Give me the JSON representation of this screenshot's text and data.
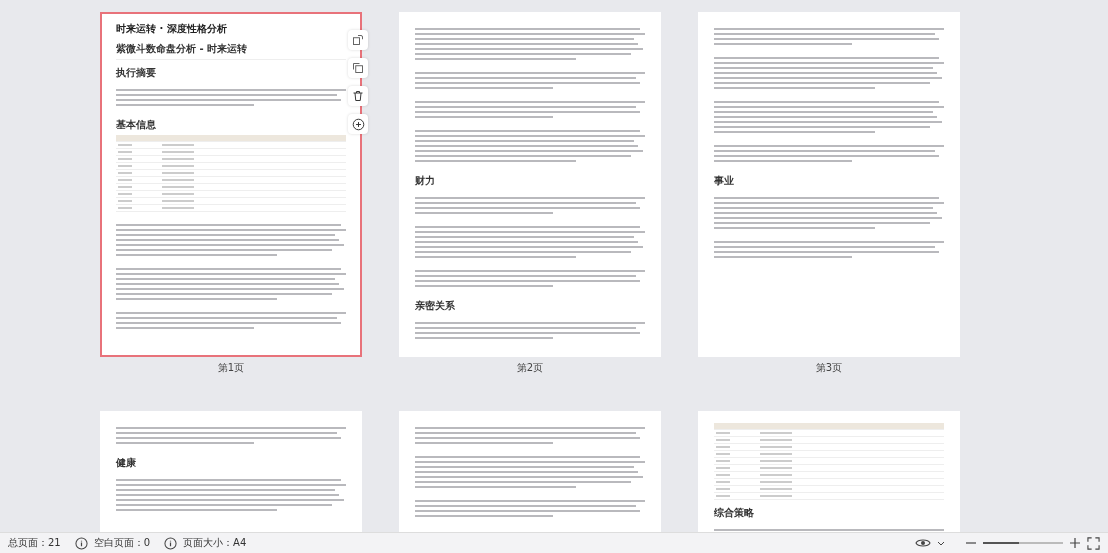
{
  "pages": [
    {
      "label": "第1页",
      "selected": true,
      "blocks": [
        {
          "kind": "h1",
          "text": "时来运转 · 深度性格分析"
        },
        {
          "kind": "h2",
          "text": "紫微斗数命盘分析 - 时来运转"
        },
        {
          "kind": "h3",
          "text": "执行摘要"
        },
        {
          "kind": "para"
        },
        {
          "kind": "h3",
          "text": "基本信息"
        },
        {
          "kind": "table"
        },
        {
          "kind": "para-long"
        },
        {
          "kind": "para-long"
        },
        {
          "kind": "para"
        }
      ]
    },
    {
      "label": "第2页",
      "selected": false,
      "blocks": [
        {
          "kind": "para-long"
        },
        {
          "kind": "para"
        },
        {
          "kind": "para"
        },
        {
          "kind": "para-long"
        },
        {
          "kind": "h3",
          "text": "财力"
        },
        {
          "kind": "para"
        },
        {
          "kind": "para-long"
        },
        {
          "kind": "para"
        },
        {
          "kind": "h3",
          "text": "亲密关系"
        },
        {
          "kind": "para"
        }
      ]
    },
    {
      "label": "第3页",
      "selected": false,
      "blocks": [
        {
          "kind": "para"
        },
        {
          "kind": "para-long"
        },
        {
          "kind": "para-long"
        },
        {
          "kind": "para"
        },
        {
          "kind": "h3",
          "text": "事业"
        },
        {
          "kind": "para-long"
        },
        {
          "kind": "para"
        }
      ]
    },
    {
      "selected": false,
      "blocks": [
        {
          "kind": "para"
        },
        {
          "kind": "h3",
          "text": "健康"
        },
        {
          "kind": "para-long"
        }
      ]
    },
    {
      "selected": false,
      "blocks": [
        {
          "kind": "para"
        },
        {
          "kind": "para-long"
        },
        {
          "kind": "para"
        }
      ]
    },
    {
      "selected": false,
      "blocks": [
        {
          "kind": "table"
        },
        {
          "kind": "h3",
          "text": "综合策略"
        },
        {
          "kind": "para"
        }
      ]
    }
  ],
  "status_bar": {
    "total": "总页面：21",
    "blank": "空白页面：0",
    "size": "页面大小：A4"
  },
  "zoom": {
    "level": 0.45
  }
}
